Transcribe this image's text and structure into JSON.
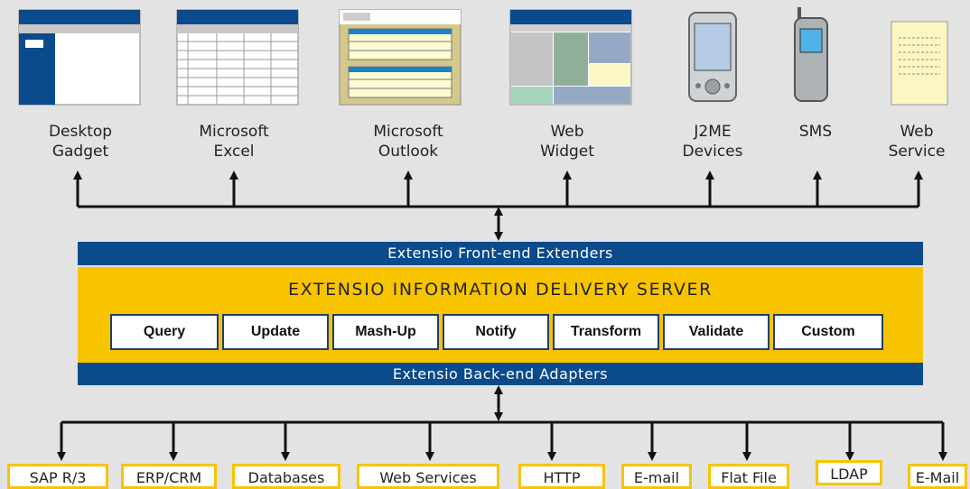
{
  "clients": [
    {
      "name": "desktop-gadget",
      "line1": "Desktop",
      "line2": "Gadget",
      "icon": "window-icon"
    },
    {
      "name": "microsoft-excel",
      "line1": "Microsoft",
      "line2": "Excel",
      "icon": "spreadsheet-icon"
    },
    {
      "name": "microsoft-outlook",
      "line1": "Microsoft",
      "line2": "Outlook",
      "icon": "mail-client-icon"
    },
    {
      "name": "web-widget",
      "line1": "Web",
      "line2": "Widget",
      "icon": "web-page-icon"
    },
    {
      "name": "j2me-devices",
      "line1": "J2ME",
      "line2": "Devices",
      "icon": "pda-icon"
    },
    {
      "name": "sms",
      "line1": "SMS",
      "line2": "",
      "icon": "mobile-phone-icon"
    },
    {
      "name": "web-service",
      "line1": "Web",
      "line2": "Service",
      "icon": "document-icon"
    }
  ],
  "front_band": "Extensio Front-end Extenders",
  "server_title": "EXTENSIO INFORMATION DELIVERY SERVER",
  "services": [
    "Query",
    "Update",
    "Mash-Up",
    "Notify",
    "Transform",
    "Validate",
    "Custom"
  ],
  "back_band": "Extensio Back-end Adapters",
  "sources": [
    "SAP R/3",
    "ERP/CRM",
    "Databases",
    "Web Services",
    "HTTP",
    "E-mail",
    "Flat File",
    "LDAP",
    "E-Mail"
  ],
  "colors": {
    "navy": "#0b4a8b",
    "gold": "#f8c400",
    "background": "#e3e3e3"
  }
}
